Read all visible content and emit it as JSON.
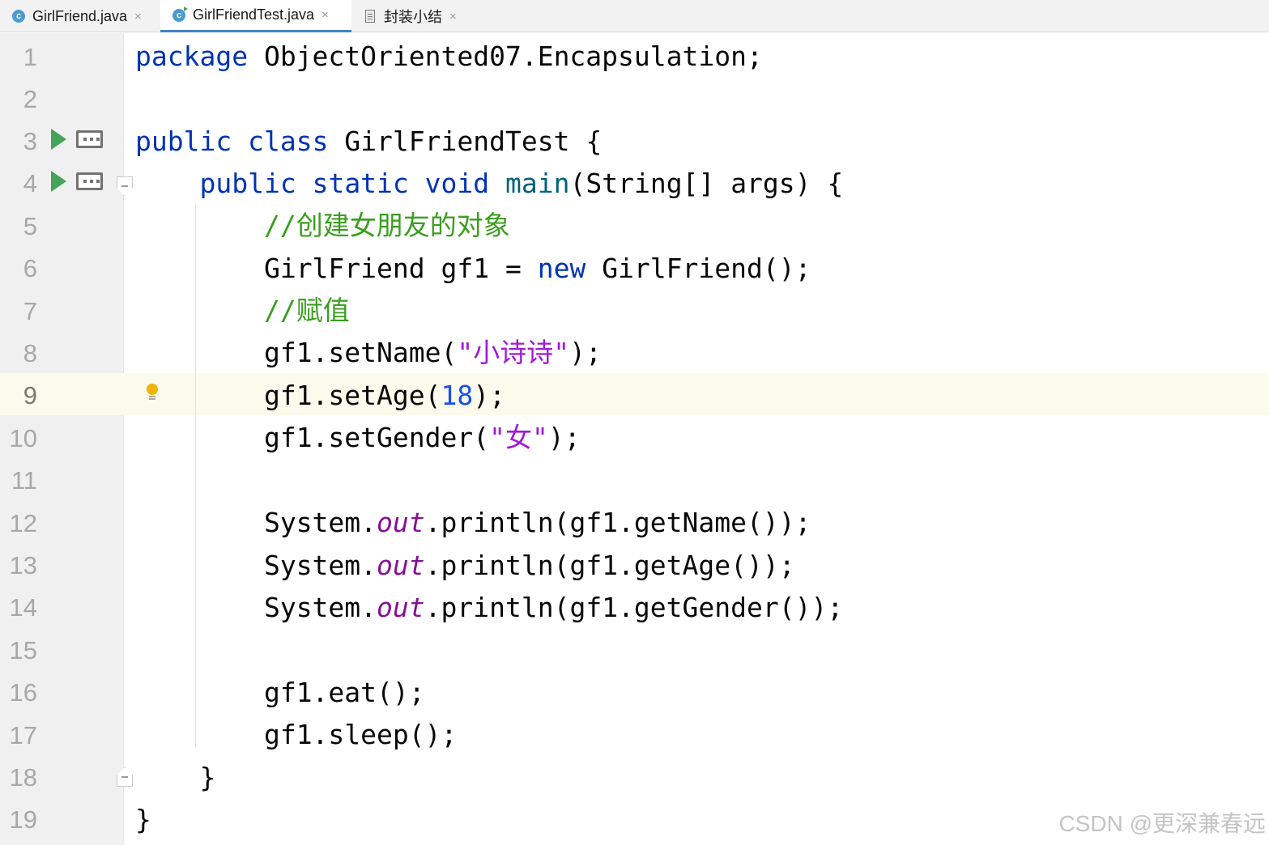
{
  "tabs": [
    {
      "label": "GirlFriend.java",
      "icon": "class-icon",
      "active": false
    },
    {
      "label": "GirlFriendTest.java",
      "icon": "runnable-class-icon",
      "active": true
    },
    {
      "label": "封装小结",
      "icon": "text-file-icon",
      "active": false
    }
  ],
  "tab_close_glyph": "×",
  "line_numbers": [
    "1",
    "2",
    "3",
    "4",
    "5",
    "6",
    "7",
    "8",
    "9",
    "10",
    "11",
    "12",
    "13",
    "14",
    "15",
    "16",
    "17",
    "18",
    "19"
  ],
  "current_line": 9,
  "code": {
    "l1": {
      "kw": "package",
      "rest": " ObjectOriented07.Encapsulation;"
    },
    "l3": {
      "kw1": "public",
      "kw2": "class",
      "rest": " GirlFriendTest {"
    },
    "l4": {
      "kw1": "public",
      "kw2": "static",
      "kw3": "void",
      "fn": "main",
      "rest": "(String[] args) {"
    },
    "l5": {
      "comment": "//创建女朋友的对象"
    },
    "l6": {
      "pre": "GirlFriend gf1 = ",
      "kw": "new",
      "rest": " GirlFriend();"
    },
    "l7": {
      "comment": "//赋值"
    },
    "l8": {
      "pre": "gf1.setName(",
      "str": "\"小诗诗\"",
      "rest": ");"
    },
    "l9": {
      "pre": "gf1.setAge(",
      "num": "18",
      "rest": ");"
    },
    "l10": {
      "pre": "gf1.setGender(",
      "str": "\"女\"",
      "rest": ");"
    },
    "l12": {
      "pre": "System.",
      "field": "out",
      "rest": ".println(gf1.getName());"
    },
    "l13": {
      "pre": "System.",
      "field": "out",
      "rest": ".println(gf1.getAge());"
    },
    "l14": {
      "pre": "System.",
      "field": "out",
      "rest": ".println(gf1.getGender());"
    },
    "l16": {
      "text": "gf1.eat();"
    },
    "l17": {
      "text": "gf1.sleep();"
    },
    "l18": {
      "text": "}"
    },
    "l19": {
      "text": "}"
    }
  },
  "colors": {
    "keyword": "#0033b3",
    "method_decl": "#00627a",
    "number": "#1750eb",
    "string": "#a31ad6",
    "comment": "#3a9e1f",
    "static_field": "#871094",
    "caret_row": "#fcfaed",
    "run_icon": "#45a25a"
  },
  "watermark": "CSDN @更深兼春远"
}
